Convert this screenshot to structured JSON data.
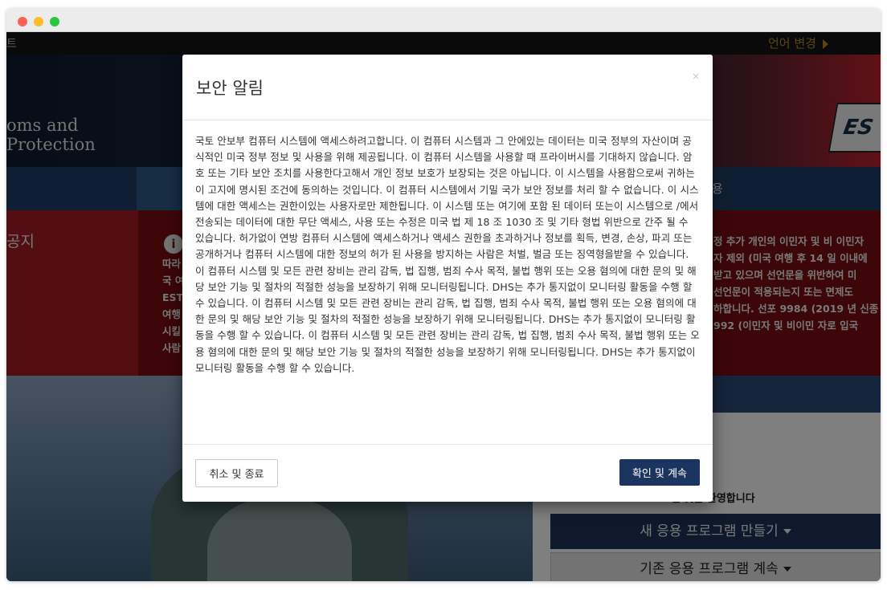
{
  "background": {
    "topbar": {
      "left_text": "트",
      "language_link": "언어 변경"
    },
    "banner": {
      "agency_line1": "oms and",
      "agency_line2": "Protection",
      "logo_text": "ES"
    },
    "nav": {
      "right_item": "용"
    },
    "notice": {
      "label": "공지",
      "left_fragments": [
        "따라",
        "국 여",
        "ESTA",
        "여행",
        "시킬",
        "사람"
      ],
      "right_fragments": [
        "정 추가 개인의 이민자 및 비 이민자",
        "자 제외 (미국 여행 후 14 일 이내에",
        "받고 있으며 선언문을 위반하여 미",
        "선언문이 적용되는지 또는 면제도",
        "하합니다. 선포 9984 (2019 년 신종",
        "992 (이민자 및 비이민 자로 입국"
      ]
    },
    "panel": {
      "welcome": "오신 것을 환영합니다",
      "new_app_button": "새 응용 프로그램 만들기",
      "continue_button": "기존 응용 프로그램 계속"
    }
  },
  "modal": {
    "title": "보안 알림",
    "close_symbol": "×",
    "body": "국토 안보부 컴퓨터 시스템에 액세스하려고합니다. 이 컴퓨터 시스템과 그 안에있는 데이터는 미국 정부의 자산이며 공식적인 미국 정부 정보 및 사용을 위해 제공됩니다. 이 컴퓨터 시스템을 사용할 때 프라이버시를 기대하지 않습니다. 암호 또는 기타 보안 조치를 사용한다고해서 개인 정보 보호가 보장되는 것은 아닙니다. 이 시스템을 사용함으로써 귀하는이 고지에 명시된 조건에 동의하는 것입니다. 이 컴퓨터 시스템에서 기밀 국가 보안 정보를 처리 할 수 없습니다. 이 시스템에 대한 액세스는 권한이있는 사용자로만 제한됩니다. 이 시스템 또는 여기에 포함 된 데이터 또는이 시스템으로 /에서 전송되는 데이터에 대한 무단 액세스, 사용 또는 수정은 미국 법 제 18 조 1030 조 및 기타 형법 위반으로 간주 될 수 있습니다. 허가없이 연방 컴퓨터 시스템에 액세스하거나 액세스 권한을 초과하거나 정보를 획득, 변경, 손상, 파괴 또는 공개하거나 컴퓨터 시스템에 대한 정보의 허가 된 사용을 방지하는 사람은 처벌, 벌금 또는 징역형을받을 수 있습니다. 이 컴퓨터 시스템 및 모든 관련 장비는 관리 감독, 법 집행, 범죄 수사 목적, 불법 행위 또는 오용 혐의에 대한 문의 및 해당 보안 기능 및 절차의 적절한 성능을 보장하기 위해 모니터링됩니다. DHS는 추가 통지없이 모니터링 활동을 수행 할 수 있습니다. 이 컴퓨터 시스템 및 모든 관련 장비는 관리 감독, 법 집행, 범죄 수사 목적, 불법 행위 또는 오용 혐의에 대한 문의 및 해당 보안 기능 및 절차의 적절한 성능을 보장하기 위해 모니터링됩니다. DHS는 추가 통지없이 모니터링 활동을 수행 할 수 있습니다. 이 컴퓨터 시스템 및 모든 관련 장비는 관리 감독, 법 집행, 범죄 수사 목적, 불법 행위 또는 오용 혐의에 대한 문의 및 해당 보안 기능 및 절차의 적절한 성능을 보장하기 위해 모니터링됩니다. DHS는 추가 통지없이 모니터링 활동을 수행 할 수 있습니다.",
    "cancel_button": "취소 및 종료",
    "confirm_button": "확인 및 계속"
  }
}
